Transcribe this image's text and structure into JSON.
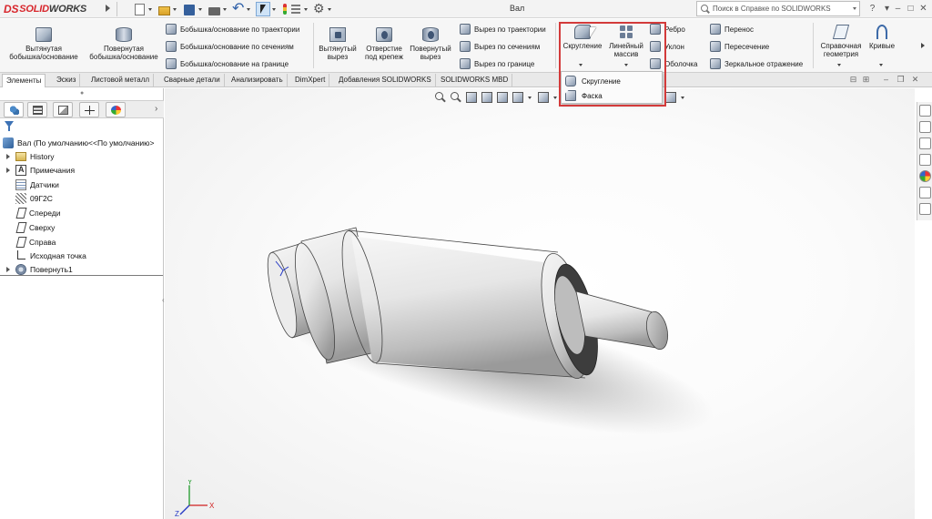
{
  "app": {
    "brand_ds": "DS",
    "brand_solid": "SOLID",
    "brand_works": "WORKS",
    "window_title": "Вал",
    "help_search_placeholder": "Поиск в Справке по SOLIDWORKS"
  },
  "ribbon": {
    "extruded_boss": "Вытянутая бобышка/основание",
    "revolved_boss": "Повернутая бобышка/основание",
    "swept_boss": "Бобышка/основание по траектории",
    "lofted_boss": "Бобышка/основание по сечениям",
    "boundary_boss": "Бобышка/основание на границе",
    "extruded_cut": "Вытянутый вырез",
    "hole_wizard": "Отверстие под крепеж",
    "revolved_cut": "Повернутый вырез",
    "swept_cut": "Вырез по траектории",
    "lofted_cut": "Вырез по сечениям",
    "boundary_cut": "Вырез по границе",
    "fillet": "Скругление",
    "linear_pattern": "Линейный массив",
    "rib": "Ребро",
    "draft": "Уклон",
    "shell": "Оболочка",
    "move": "Перенос",
    "intersect": "Пересечение",
    "mirror": "Зеркальное отражение",
    "ref_geometry": "Справочная геометрия",
    "curves": "Кривые"
  },
  "fillet_dropdown": {
    "items": [
      "Скругление",
      "Фаска"
    ]
  },
  "tabs": [
    "Элементы",
    "Эскиз",
    "Листовой металл",
    "Сварные детали",
    "Анализировать",
    "DimXpert",
    "Добавления SOLIDWORKS",
    "SOLIDWORKS MBD"
  ],
  "active_tab": "Элементы",
  "feature_tree": {
    "root": "Вал  (По умолчанию<<По умолчанию>",
    "items": [
      {
        "label": "History",
        "icon": "folder-icon",
        "expandable": true
      },
      {
        "label": "Примечания",
        "icon": "annotations-icon",
        "expandable": true
      },
      {
        "label": "Датчики",
        "icon": "sensors-icon",
        "expandable": false
      },
      {
        "label": "09Г2С",
        "icon": "material-icon",
        "expandable": false
      },
      {
        "label": "Спереди",
        "icon": "plane-icon",
        "expandable": false
      },
      {
        "label": "Сверху",
        "icon": "plane-icon",
        "expandable": false
      },
      {
        "label": "Справа",
        "icon": "plane-icon",
        "expandable": false
      },
      {
        "label": "Исходная точка",
        "icon": "origin-icon",
        "expandable": false
      },
      {
        "label": "Повернуть1",
        "icon": "revolve-icon",
        "expandable": true
      }
    ]
  },
  "triad": {
    "x": "X",
    "y": "Y",
    "z": "Z"
  },
  "colors": {
    "highlight": "#d33a3a",
    "brand": "#d8262c",
    "axis_x": "#d02020",
    "axis_y": "#1f9a2a",
    "axis_z": "#2438c4"
  }
}
